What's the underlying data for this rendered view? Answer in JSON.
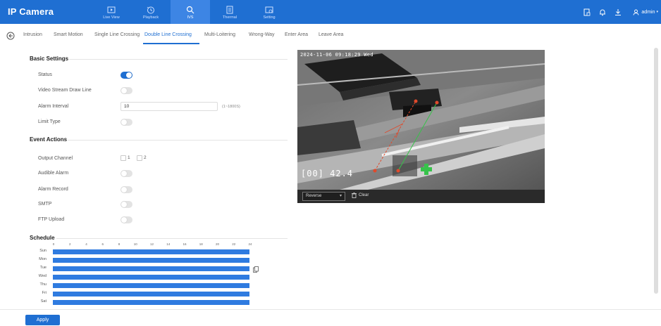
{
  "app": {
    "title": "IP Camera"
  },
  "nav": [
    {
      "label": "Live View",
      "icon": "live-view-icon"
    },
    {
      "label": "Playback",
      "icon": "playback-icon"
    },
    {
      "label": "IVS",
      "icon": "ivs-icon",
      "active": true
    },
    {
      "label": "Thermal",
      "icon": "thermal-icon"
    },
    {
      "label": "Setting",
      "icon": "setting-icon"
    }
  ],
  "header_right": {
    "user": "admin"
  },
  "tabs": [
    {
      "label": "Intrusion"
    },
    {
      "label": "Smart Motion"
    },
    {
      "label": "Single Line Crossing"
    },
    {
      "label": "Double Line Crossing",
      "active": true
    },
    {
      "label": "Multi-Loitering"
    },
    {
      "label": "Wrong-Way"
    },
    {
      "label": "Enter Area"
    },
    {
      "label": "Leave Area"
    }
  ],
  "basic_settings": {
    "title": "Basic Settings",
    "status_label": "Status",
    "status_on": true,
    "draw_line_label": "Video Stream Draw Line",
    "draw_line_on": false,
    "alarm_interval_label": "Alarm Interval",
    "alarm_interval_value": "10",
    "alarm_interval_hint": "(1~1800S)",
    "limit_type_label": "Limit Type",
    "limit_type_on": false
  },
  "event_actions": {
    "title": "Event Actions",
    "output_channel_label": "Output Channel",
    "output_channels": [
      "1",
      "2"
    ],
    "audible_alarm_label": "Audible Alarm",
    "alarm_record_label": "Alarm Record",
    "smtp_label": "SMTP",
    "ftp_upload_label": "FTP Upload"
  },
  "schedule": {
    "title": "Schedule",
    "hours": [
      "0",
      "2",
      "4",
      "6",
      "8",
      "10",
      "12",
      "14",
      "16",
      "18",
      "20",
      "22",
      "24"
    ],
    "days": [
      "Sun",
      "Mon",
      "Tue",
      "Wed",
      "Thu",
      "Fri",
      "Sat"
    ],
    "fill_fraction": 1.0
  },
  "video": {
    "osd_time": "2024-11-06 09:18:29 Wed",
    "osd_temp": "[00] 42.4",
    "direction_value": "Reverse",
    "clear_label": "Clear"
  },
  "footer": {
    "apply_label": "Apply"
  },
  "colors": {
    "primary": "#1f6fd2",
    "line_red": "#e04a2c",
    "line_green": "#37c24a"
  }
}
